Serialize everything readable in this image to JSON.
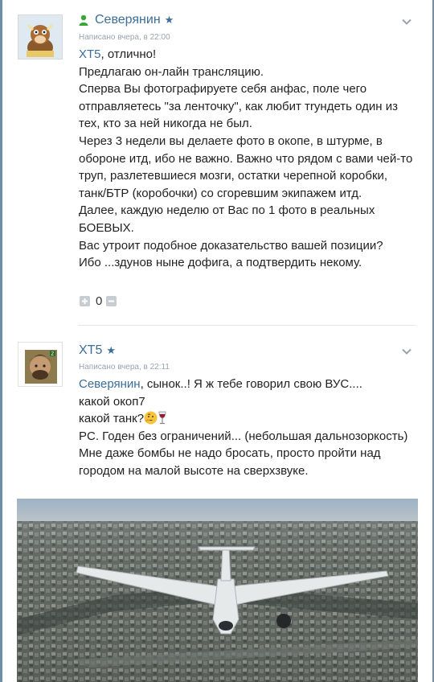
{
  "posts": [
    {
      "author": "Северянин",
      "meta": "Написано вчера, в 22:00",
      "lines": [
        [
          {
            "t": "ХТ5",
            "mention": true
          },
          {
            "t": ", отлично!"
          }
        ],
        [
          {
            "t": "Предлагаю он-лайн трансляцию."
          }
        ],
        [
          {
            "t": "Сперва Вы фотографируете себя анфас, поле чего отправляетесь \"за ленточку\", как любит тryндеть один из тех, кто за ней никогда не был."
          }
        ],
        [
          {
            "t": "Через 3 недели вы делаете фото в окопе, в штурме, в обороне итд, ибо не важно. Важно что рядом с вами чей-то труп, разлетевшиеся мозги, остатки черепной коробки, танк/БТР (коробочки) со сгоревшим экипажем итд."
          }
        ],
        [
          {
            "t": "Далее, каждую неделю от Вас по 1 фото в реальных БОЕВЫХ."
          }
        ],
        [
          {
            "t": "Вас утроит подобное доказательство вашей позиции?"
          }
        ],
        [
          {
            "t": "Ибо ...здунов ныне дофига, а подтвердить некому."
          }
        ]
      ],
      "vote_count": "0"
    },
    {
      "author": "ХТ5",
      "meta": "Написано вчера, в 22:11",
      "lines": [
        [
          {
            "t": "Северянин",
            "mention": true
          },
          {
            "t": ", сынок..! Я ж тебе говорил свою ВУС...."
          }
        ],
        [
          {
            "t": "какой окоп7"
          }
        ],
        [
          {
            "t": "какой танк?"
          },
          {
            "emoji": "thinking"
          },
          {
            "emoji": "wine"
          }
        ],
        [
          {
            "t": "PC. Годен без ограничений... (небольшая дальнозоркость) Мне даже бомбы не надо бросать, просто пройти над городом на малой высоте на сверхзвуке."
          }
        ]
      ]
    }
  ],
  "colors": {
    "link": "#3b6e99",
    "meta": "#9aa3ad",
    "online": "#3aa63a"
  },
  "icons": [
    "online-user-icon",
    "star-icon",
    "chevron-down-icon",
    "vote-up-icon",
    "vote-down-icon",
    "thinking-face-emoji",
    "wine-glass-emoji"
  ]
}
